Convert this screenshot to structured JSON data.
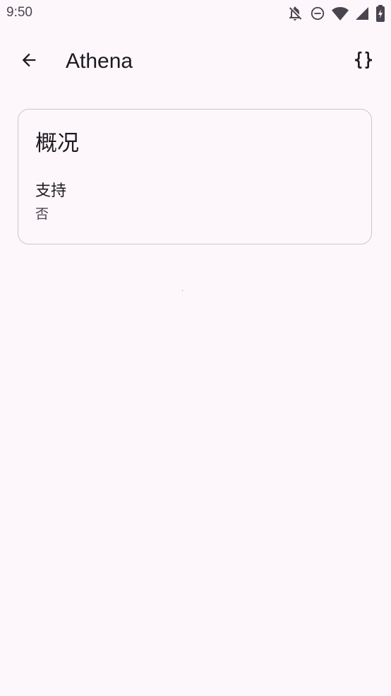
{
  "status_bar": {
    "time": "9:50",
    "icons": [
      "notifications-off-icon",
      "do-not-disturb-icon",
      "wifi-icon",
      "cellular-signal-icon",
      "battery-charging-icon"
    ]
  },
  "app_bar": {
    "title": "Athena",
    "back_icon": "arrow-back-icon",
    "action_icon": "code-braces-icon"
  },
  "overview_card": {
    "title": "概况",
    "fields": [
      {
        "label": "支持",
        "value": "否"
      }
    ]
  },
  "colors": {
    "background": "#fdf7fc",
    "text_primary": "#1d1b20",
    "text_secondary": "#49454f",
    "card_border": "#cac4d0"
  }
}
